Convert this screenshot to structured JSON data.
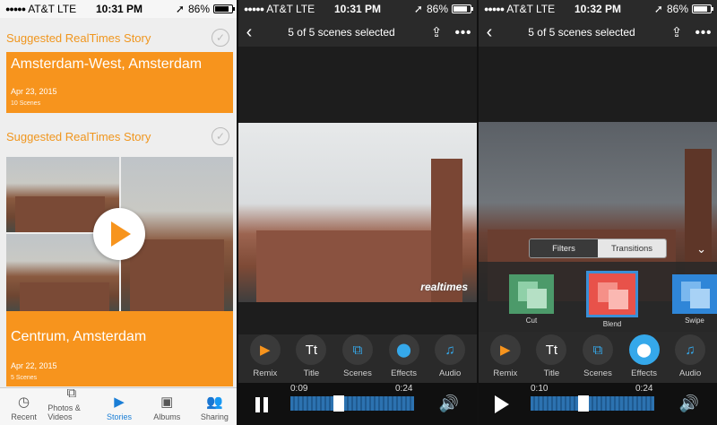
{
  "status": {
    "carrier": "AT&T",
    "network": "LTE",
    "battery": "86%",
    "time_1": "10:31 PM",
    "time_2": "10:31 PM",
    "time_3": "10:32 PM"
  },
  "stories": {
    "suggested_label": "Suggested RealTimes Story",
    "card1": {
      "title": "Amsterdam-West, Amsterdam",
      "date": "Apr 23, 2015",
      "scenes": "10 Scenes"
    },
    "card2": {
      "title": "Centrum, Amsterdam",
      "date": "Apr 22, 2015",
      "scenes": "5 Scenes"
    }
  },
  "tabs": [
    {
      "label": "Recent",
      "icon": "clock-icon"
    },
    {
      "label": "Photos & Videos",
      "icon": "photos-icon"
    },
    {
      "label": "Stories",
      "icon": "stories-icon"
    },
    {
      "label": "Albums",
      "icon": "albums-icon"
    },
    {
      "label": "Sharing",
      "icon": "people-icon"
    }
  ],
  "editor": {
    "title": "5 of 5 scenes selected",
    "watermark": "realtimes",
    "tools": [
      "Remix",
      "Title",
      "Scenes",
      "Effects",
      "Audio"
    ],
    "title_tool_glyph": "Tt",
    "player1": {
      "start": "0:09",
      "end": "0:24",
      "progress": 0.38
    },
    "player2": {
      "start": "0:10",
      "end": "0:24",
      "progress": 0.42
    },
    "segments": {
      "filters": "Filters",
      "transitions": "Transitions"
    },
    "transitions": [
      "Cut",
      "Blend",
      "Swipe"
    ]
  },
  "colors": {
    "accent": "#f7941d",
    "tab_active": "#1a7ed6",
    "highlight": "#35a8ea"
  }
}
